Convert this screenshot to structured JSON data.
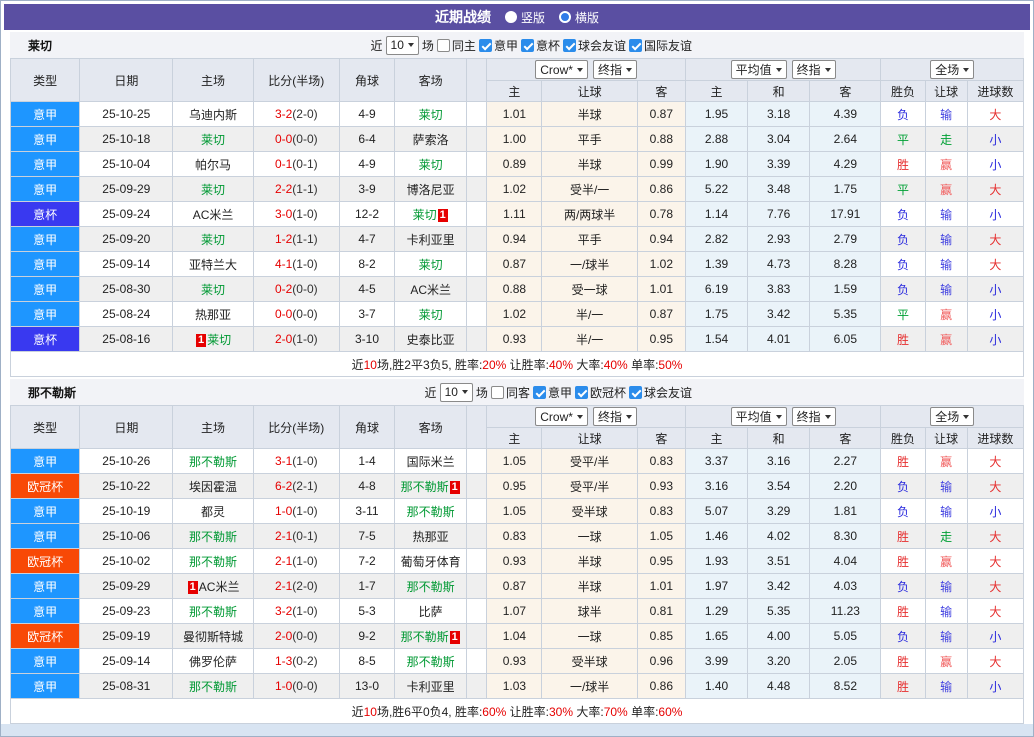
{
  "title_bar": {
    "title": "近期战绩",
    "vertical": "竖版",
    "horizontal": "横版"
  },
  "colors": {
    "titlebar": "#5a4fa2",
    "type_badges": {
      "意甲": "#1e96ff",
      "意杯": "#3939f0",
      "欧冠杯": "#f84906"
    },
    "outcome": {
      "胜": "#e62e2e",
      "平": "#00a035",
      "负": "#2929dd",
      "赢": "#f05a5a",
      "走": "#00a035",
      "输": "#3d3de0",
      "大": "#e62e2e",
      "小": "#2929dd"
    },
    "team_highlight": "#009933",
    "score_red": "#e60000",
    "summary_red": "#e60000"
  },
  "table_headers": {
    "main": [
      "类型",
      "日期",
      "主场",
      "比分(半场)",
      "角球",
      "客场"
    ],
    "sub": [
      "主",
      "让球",
      "客",
      "主",
      "和",
      "客",
      "胜负",
      "让球",
      "进球数"
    ],
    "odds_source_select": "Crow*",
    "odds_time_select": "终指",
    "avg_select": "平均值",
    "avg_time_select": "终指",
    "scope_select": "全场"
  },
  "sections": [
    {
      "team": "莱切",
      "filter": {
        "near_label": "近",
        "count_value": "10",
        "unit_label": "场",
        "same_label": "同主",
        "same_checked": false,
        "competitions": [
          "意甲",
          "意杯",
          "球会友谊",
          "国际友谊"
        ]
      },
      "rows": [
        {
          "type": "意甲",
          "date": "25-10-25",
          "home": "乌迪内斯",
          "home_highlight": false,
          "home_badge": "",
          "score": "3-2",
          "half": "(2-0)",
          "corners": "4-9",
          "away": "莱切",
          "away_highlight": true,
          "away_badge": "",
          "odds_home": "1.01",
          "handicap": "半球",
          "odds_away": "0.87",
          "avg_home": "1.95",
          "avg_draw": "3.18",
          "avg_away": "4.39",
          "outcome": "负",
          "handicap_outcome": "输",
          "goals_outcome": "大"
        },
        {
          "type": "意甲",
          "date": "25-10-18",
          "home": "莱切",
          "home_highlight": true,
          "home_badge": "",
          "score": "0-0",
          "half": "(0-0)",
          "corners": "6-4",
          "away": "萨索洛",
          "away_highlight": false,
          "away_badge": "",
          "odds_home": "1.00",
          "handicap": "平手",
          "odds_away": "0.88",
          "avg_home": "2.88",
          "avg_draw": "3.04",
          "avg_away": "2.64",
          "outcome": "平",
          "handicap_outcome": "走",
          "goals_outcome": "小"
        },
        {
          "type": "意甲",
          "date": "25-10-04",
          "home": "帕尔马",
          "home_highlight": false,
          "home_badge": "",
          "score": "0-1",
          "half": "(0-1)",
          "corners": "4-9",
          "away": "莱切",
          "away_highlight": true,
          "away_badge": "",
          "odds_home": "0.89",
          "handicap": "半球",
          "odds_away": "0.99",
          "avg_home": "1.90",
          "avg_draw": "3.39",
          "avg_away": "4.29",
          "outcome": "胜",
          "handicap_outcome": "赢",
          "goals_outcome": "小"
        },
        {
          "type": "意甲",
          "date": "25-09-29",
          "home": "莱切",
          "home_highlight": true,
          "home_badge": "",
          "score": "2-2",
          "half": "(1-1)",
          "corners": "3-9",
          "away": "博洛尼亚",
          "away_highlight": false,
          "away_badge": "",
          "odds_home": "1.02",
          "handicap": "受半/一",
          "odds_away": "0.86",
          "avg_home": "5.22",
          "avg_draw": "3.48",
          "avg_away": "1.75",
          "outcome": "平",
          "handicap_outcome": "赢",
          "goals_outcome": "大"
        },
        {
          "type": "意杯",
          "date": "25-09-24",
          "home": "AC米兰",
          "home_highlight": false,
          "home_badge": "",
          "score": "3-0",
          "half": "(1-0)",
          "corners": "12-2",
          "away": "莱切",
          "away_highlight": true,
          "away_badge": "1",
          "odds_home": "1.11",
          "handicap": "两/两球半",
          "odds_away": "0.78",
          "avg_home": "1.14",
          "avg_draw": "7.76",
          "avg_away": "17.91",
          "outcome": "负",
          "handicap_outcome": "输",
          "goals_outcome": "小"
        },
        {
          "type": "意甲",
          "date": "25-09-20",
          "home": "莱切",
          "home_highlight": true,
          "home_badge": "",
          "score": "1-2",
          "half": "(1-1)",
          "corners": "4-7",
          "away": "卡利亚里",
          "away_highlight": false,
          "away_badge": "",
          "odds_home": "0.94",
          "handicap": "平手",
          "odds_away": "0.94",
          "avg_home": "2.82",
          "avg_draw": "2.93",
          "avg_away": "2.79",
          "outcome": "负",
          "handicap_outcome": "输",
          "goals_outcome": "大"
        },
        {
          "type": "意甲",
          "date": "25-09-14",
          "home": "亚特兰大",
          "home_highlight": false,
          "home_badge": "",
          "score": "4-1",
          "half": "(1-0)",
          "corners": "8-2",
          "away": "莱切",
          "away_highlight": true,
          "away_badge": "",
          "odds_home": "0.87",
          "handicap": "一/球半",
          "odds_away": "1.02",
          "avg_home": "1.39",
          "avg_draw": "4.73",
          "avg_away": "8.28",
          "outcome": "负",
          "handicap_outcome": "输",
          "goals_outcome": "大"
        },
        {
          "type": "意甲",
          "date": "25-08-30",
          "home": "莱切",
          "home_highlight": true,
          "home_badge": "",
          "score": "0-2",
          "half": "(0-0)",
          "corners": "4-5",
          "away": "AC米兰",
          "away_highlight": false,
          "away_badge": "",
          "odds_home": "0.88",
          "handicap": "受一球",
          "odds_away": "1.01",
          "avg_home": "6.19",
          "avg_draw": "3.83",
          "avg_away": "1.59",
          "outcome": "负",
          "handicap_outcome": "输",
          "goals_outcome": "小"
        },
        {
          "type": "意甲",
          "date": "25-08-24",
          "home": "热那亚",
          "home_highlight": false,
          "home_badge": "",
          "score": "0-0",
          "half": "(0-0)",
          "corners": "3-7",
          "away": "莱切",
          "away_highlight": true,
          "away_badge": "",
          "odds_home": "1.02",
          "handicap": "半/一",
          "odds_away": "0.87",
          "avg_home": "1.75",
          "avg_draw": "3.42",
          "avg_away": "5.35",
          "outcome": "平",
          "handicap_outcome": "赢",
          "goals_outcome": "小"
        },
        {
          "type": "意杯",
          "date": "25-08-16",
          "home": "莱切",
          "home_highlight": true,
          "home_badge": "1",
          "score": "2-0",
          "half": "(1-0)",
          "corners": "3-10",
          "away": "史泰比亚",
          "away_highlight": false,
          "away_badge": "",
          "odds_home": "0.93",
          "handicap": "半/一",
          "odds_away": "0.95",
          "avg_home": "1.54",
          "avg_draw": "4.01",
          "avg_away": "6.05",
          "outcome": "胜",
          "handicap_outcome": "赢",
          "goals_outcome": "小"
        }
      ],
      "summary": [
        {
          "text": "近",
          "red": false
        },
        {
          "text": "10",
          "red": true
        },
        {
          "text": "场,胜2平3负5, 胜率:",
          "red": false
        },
        {
          "text": "20%",
          "red": true
        },
        {
          "text": " 让胜率:",
          "red": false
        },
        {
          "text": "40%",
          "red": true
        },
        {
          "text": " 大率:",
          "red": false
        },
        {
          "text": "40%",
          "red": true
        },
        {
          "text": " 单率:",
          "red": false
        },
        {
          "text": "50%",
          "red": true
        }
      ]
    },
    {
      "team": "那不勒斯",
      "filter": {
        "near_label": "近",
        "count_value": "10",
        "unit_label": "场",
        "same_label": "同客",
        "same_checked": false,
        "competitions": [
          "意甲",
          "欧冠杯",
          "球会友谊"
        ]
      },
      "rows": [
        {
          "type": "意甲",
          "date": "25-10-26",
          "home": "那不勒斯",
          "home_highlight": true,
          "home_badge": "",
          "score": "3-1",
          "half": "(1-0)",
          "corners": "1-4",
          "away": "国际米兰",
          "away_highlight": false,
          "away_badge": "",
          "odds_home": "1.05",
          "handicap": "受平/半",
          "odds_away": "0.83",
          "avg_home": "3.37",
          "avg_draw": "3.16",
          "avg_away": "2.27",
          "outcome": "胜",
          "handicap_outcome": "赢",
          "goals_outcome": "大"
        },
        {
          "type": "欧冠杯",
          "date": "25-10-22",
          "home": "埃因霍温",
          "home_highlight": false,
          "home_badge": "",
          "score": "6-2",
          "half": "(2-1)",
          "corners": "4-8",
          "away": "那不勒斯",
          "away_highlight": true,
          "away_badge": "1",
          "odds_home": "0.95",
          "handicap": "受平/半",
          "odds_away": "0.93",
          "avg_home": "3.16",
          "avg_draw": "3.54",
          "avg_away": "2.20",
          "outcome": "负",
          "handicap_outcome": "输",
          "goals_outcome": "大"
        },
        {
          "type": "意甲",
          "date": "25-10-19",
          "home": "都灵",
          "home_highlight": false,
          "home_badge": "",
          "score": "1-0",
          "half": "(1-0)",
          "corners": "3-11",
          "away": "那不勒斯",
          "away_highlight": true,
          "away_badge": "",
          "odds_home": "1.05",
          "handicap": "受半球",
          "odds_away": "0.83",
          "avg_home": "5.07",
          "avg_draw": "3.29",
          "avg_away": "1.81",
          "outcome": "负",
          "handicap_outcome": "输",
          "goals_outcome": "小"
        },
        {
          "type": "意甲",
          "date": "25-10-06",
          "home": "那不勒斯",
          "home_highlight": true,
          "home_badge": "",
          "score": "2-1",
          "half": "(0-1)",
          "corners": "7-5",
          "away": "热那亚",
          "away_highlight": false,
          "away_badge": "",
          "odds_home": "0.83",
          "handicap": "一球",
          "odds_away": "1.05",
          "avg_home": "1.46",
          "avg_draw": "4.02",
          "avg_away": "8.30",
          "outcome": "胜",
          "handicap_outcome": "走",
          "goals_outcome": "大"
        },
        {
          "type": "欧冠杯",
          "date": "25-10-02",
          "home": "那不勒斯",
          "home_highlight": true,
          "home_badge": "",
          "score": "2-1",
          "half": "(1-0)",
          "corners": "7-2",
          "away": "葡萄牙体育",
          "away_highlight": false,
          "away_badge": "",
          "odds_home": "0.93",
          "handicap": "半球",
          "odds_away": "0.95",
          "avg_home": "1.93",
          "avg_draw": "3.51",
          "avg_away": "4.04",
          "outcome": "胜",
          "handicap_outcome": "赢",
          "goals_outcome": "大"
        },
        {
          "type": "意甲",
          "date": "25-09-29",
          "home": "AC米兰",
          "home_highlight": false,
          "home_badge": "1",
          "score": "2-1",
          "half": "(2-0)",
          "corners": "1-7",
          "away": "那不勒斯",
          "away_highlight": true,
          "away_badge": "",
          "odds_home": "0.87",
          "handicap": "半球",
          "odds_away": "1.01",
          "avg_home": "1.97",
          "avg_draw": "3.42",
          "avg_away": "4.03",
          "outcome": "负",
          "handicap_outcome": "输",
          "goals_outcome": "大"
        },
        {
          "type": "意甲",
          "date": "25-09-23",
          "home": "那不勒斯",
          "home_highlight": true,
          "home_badge": "",
          "score": "3-2",
          "half": "(1-0)",
          "corners": "5-3",
          "away": "比萨",
          "away_highlight": false,
          "away_badge": "",
          "odds_home": "1.07",
          "handicap": "球半",
          "odds_away": "0.81",
          "avg_home": "1.29",
          "avg_draw": "5.35",
          "avg_away": "11.23",
          "outcome": "胜",
          "handicap_outcome": "输",
          "goals_outcome": "大"
        },
        {
          "type": "欧冠杯",
          "date": "25-09-19",
          "home": "曼彻斯特城",
          "home_highlight": false,
          "home_badge": "",
          "score": "2-0",
          "half": "(0-0)",
          "corners": "9-2",
          "away": "那不勒斯",
          "away_highlight": true,
          "away_badge": "1",
          "odds_home": "1.04",
          "handicap": "一球",
          "odds_away": "0.85",
          "avg_home": "1.65",
          "avg_draw": "4.00",
          "avg_away": "5.05",
          "outcome": "负",
          "handicap_outcome": "输",
          "goals_outcome": "小"
        },
        {
          "type": "意甲",
          "date": "25-09-14",
          "home": "佛罗伦萨",
          "home_highlight": false,
          "home_badge": "",
          "score": "1-3",
          "half": "(0-2)",
          "corners": "8-5",
          "away": "那不勒斯",
          "away_highlight": true,
          "away_badge": "",
          "odds_home": "0.93",
          "handicap": "受半球",
          "odds_away": "0.96",
          "avg_home": "3.99",
          "avg_draw": "3.20",
          "avg_away": "2.05",
          "outcome": "胜",
          "handicap_outcome": "赢",
          "goals_outcome": "大"
        },
        {
          "type": "意甲",
          "date": "25-08-31",
          "home": "那不勒斯",
          "home_highlight": true,
          "home_badge": "",
          "score": "1-0",
          "half": "(0-0)",
          "corners": "13-0",
          "away": "卡利亚里",
          "away_highlight": false,
          "away_badge": "",
          "odds_home": "1.03",
          "handicap": "一/球半",
          "odds_away": "0.86",
          "avg_home": "1.40",
          "avg_draw": "4.48",
          "avg_away": "8.52",
          "outcome": "胜",
          "handicap_outcome": "输",
          "goals_outcome": "小"
        }
      ],
      "summary": [
        {
          "text": "近",
          "red": false
        },
        {
          "text": "10",
          "red": true
        },
        {
          "text": "场,胜6平0负4, 胜率:",
          "red": false
        },
        {
          "text": "60%",
          "red": true
        },
        {
          "text": " 让胜率:",
          "red": false
        },
        {
          "text": "30%",
          "red": true
        },
        {
          "text": " 大率:",
          "red": false
        },
        {
          "text": "70%",
          "red": true
        },
        {
          "text": " 单率:",
          "red": false
        },
        {
          "text": "60%",
          "red": true
        }
      ]
    }
  ]
}
